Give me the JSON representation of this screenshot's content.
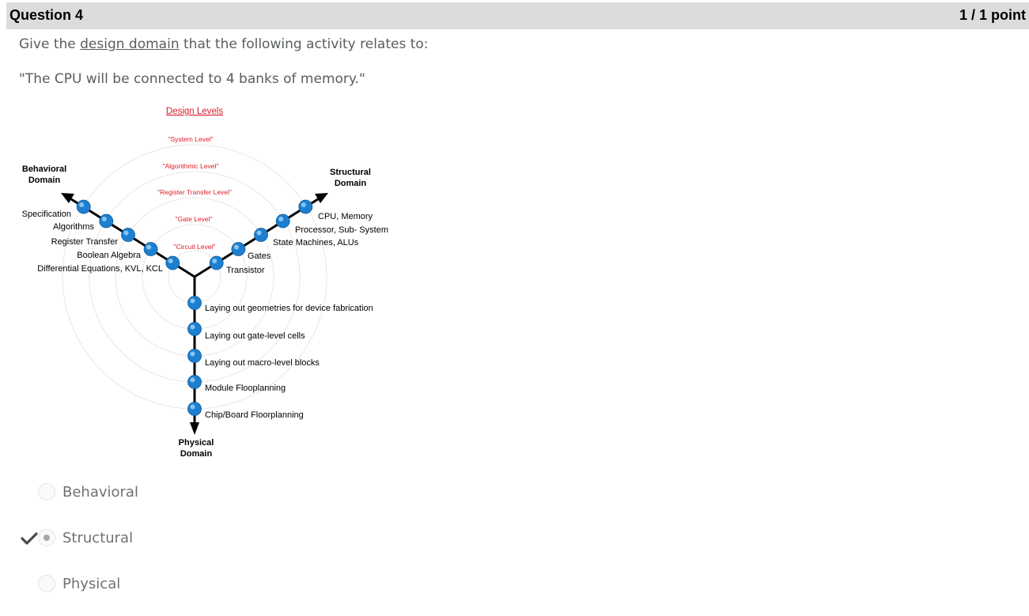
{
  "question": {
    "title": "Question 4",
    "score": "1 / 1 point"
  },
  "prompt": {
    "before": "Give the ",
    "link": "design domain",
    "after": " that the following activity relates to:"
  },
  "quote": "\"The CPU will be connected to 4 banks of memory.\"",
  "diagram": {
    "title": "Design Levels",
    "levels": [
      "\"System Level\"",
      "\"Algorithmic Level\"",
      "\"Register Transfer Level\"",
      "\"Gate Level\"",
      "\"Circuit Level\""
    ],
    "behavioral_title": [
      "Behavioral",
      "Domain"
    ],
    "structural_title": [
      "Structural",
      "Domain"
    ],
    "physical_title": [
      "Physical",
      "Domain"
    ],
    "behavioral_items": [
      "Specification",
      "Algorithms",
      "Register Transfer",
      "Boolean Algebra",
      "Differential Equations, KVL, KCL"
    ],
    "structural_items": [
      "CPU, Memory",
      "Processor, Sub- System",
      "State Machines, ALUs",
      "Gates",
      "Transistor"
    ],
    "physical_items": [
      "Laying out geometries for device fabrication",
      "Laying out gate-level cells",
      "Laying out macro-level blocks",
      "Module Flooplanning",
      "Chip/Board Floorplanning"
    ],
    "colors": {
      "level_text": "#d9202a",
      "node": "#1d7fd0"
    }
  },
  "choices": [
    {
      "label": "Behavioral",
      "selected": false
    },
    {
      "label": "Structural",
      "selected": true
    },
    {
      "label": "Physical",
      "selected": false
    }
  ],
  "check_icon": "checkmark-icon"
}
